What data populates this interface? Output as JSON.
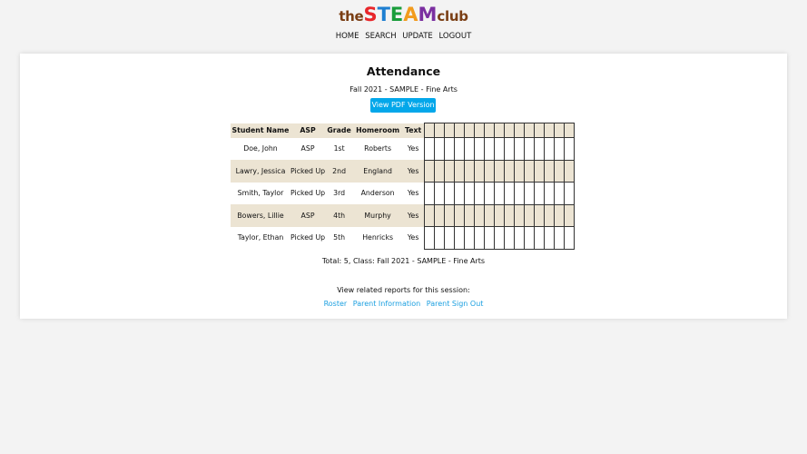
{
  "logo": {
    "prefix": "the",
    "letters": [
      "S",
      "T",
      "E",
      "A",
      "M"
    ],
    "suffix": "club"
  },
  "nav": {
    "items": [
      {
        "label": "HOME"
      },
      {
        "label": "SEARCH"
      },
      {
        "label": "UPDATE"
      },
      {
        "label": "LOGOUT"
      }
    ]
  },
  "report": {
    "title": "Attendance",
    "subtitle": "Fall 2021 - SAMPLE - Fine Arts",
    "pdf_button": "View PDF Version",
    "headers": [
      "Student Name",
      "ASP",
      "Grade",
      "Homeroom",
      "Text"
    ],
    "attendance_columns": 15,
    "rows": [
      {
        "name": "Doe, John",
        "asp": "ASP",
        "grade": "1st",
        "homeroom": "Roberts",
        "text": "Yes"
      },
      {
        "name": "Lawry, Jessica",
        "asp": "Picked Up",
        "grade": "2nd",
        "homeroom": "England",
        "text": "Yes"
      },
      {
        "name": "Smith, Taylor",
        "asp": "Picked Up",
        "grade": "3rd",
        "homeroom": "Anderson",
        "text": "Yes"
      },
      {
        "name": "Bowers, Lillie",
        "asp": "ASP",
        "grade": "4th",
        "homeroom": "Murphy",
        "text": "Yes"
      },
      {
        "name": "Taylor, Ethan",
        "asp": "Picked Up",
        "grade": "5th",
        "homeroom": "Henricks",
        "text": "Yes"
      }
    ],
    "total": "Total: 5, Class: Fall 2021 - SAMPLE - Fine Arts",
    "related_label": "View related reports for this session:",
    "related_links": [
      {
        "label": "Roster"
      },
      {
        "label": "Parent Information"
      },
      {
        "label": "Parent Sign Out"
      }
    ]
  },
  "colors": {
    "page_bg": "#f3f3f3",
    "row_stripe": "#ece4d3",
    "button": "#03a7ea",
    "link": "#1a9fe0",
    "logo_brown": "#7a3e14"
  }
}
